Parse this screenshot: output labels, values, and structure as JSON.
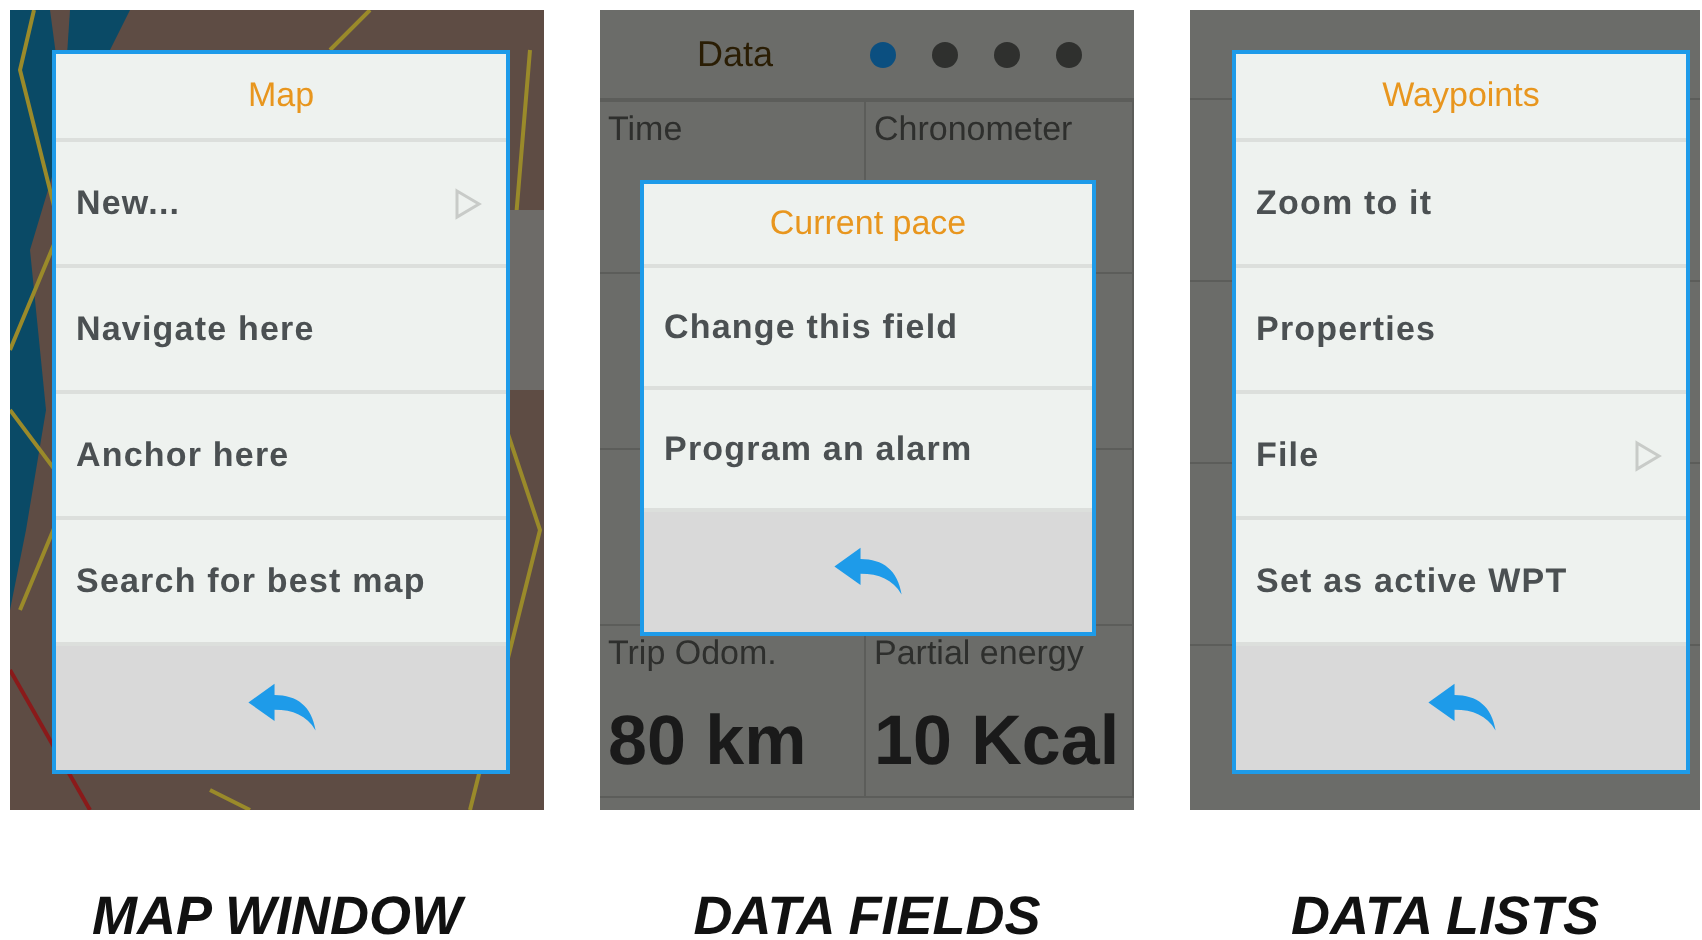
{
  "panels": [
    {
      "kind": "map",
      "caption": "MAP WINDOW",
      "menu": {
        "title": "Map",
        "items": [
          {
            "label": "New...",
            "submenu": true
          },
          {
            "label": "Navigate here",
            "submenu": false
          },
          {
            "label": "Anchor here",
            "submenu": false
          },
          {
            "label": "Search for best map",
            "submenu": false
          }
        ]
      }
    },
    {
      "kind": "data",
      "caption": "DATA FIELDS",
      "background": {
        "title": "Data",
        "pages": [
          {
            "selected": true
          },
          {
            "selected": false
          },
          {
            "selected": false
          },
          {
            "selected": false
          }
        ],
        "fields": [
          {
            "label": "Time"
          },
          {
            "label": "Chronometer"
          },
          {
            "label": "Trip Odom.",
            "value": "80 km"
          },
          {
            "label": "Partial energy",
            "value": "10 Kcal"
          }
        ]
      },
      "menu": {
        "title": "Current pace",
        "items": [
          {
            "label": "Change this field",
            "submenu": false
          },
          {
            "label": "Program an alarm",
            "submenu": false
          }
        ]
      }
    },
    {
      "kind": "list",
      "caption": "DATA LISTS",
      "menu": {
        "title": "Waypoints",
        "items": [
          {
            "label": "Zoom to it",
            "submenu": false
          },
          {
            "label": "Properties",
            "submenu": false
          },
          {
            "label": "File",
            "submenu": true
          },
          {
            "label": "Set as active WPT",
            "submenu": false
          }
        ]
      }
    }
  ]
}
